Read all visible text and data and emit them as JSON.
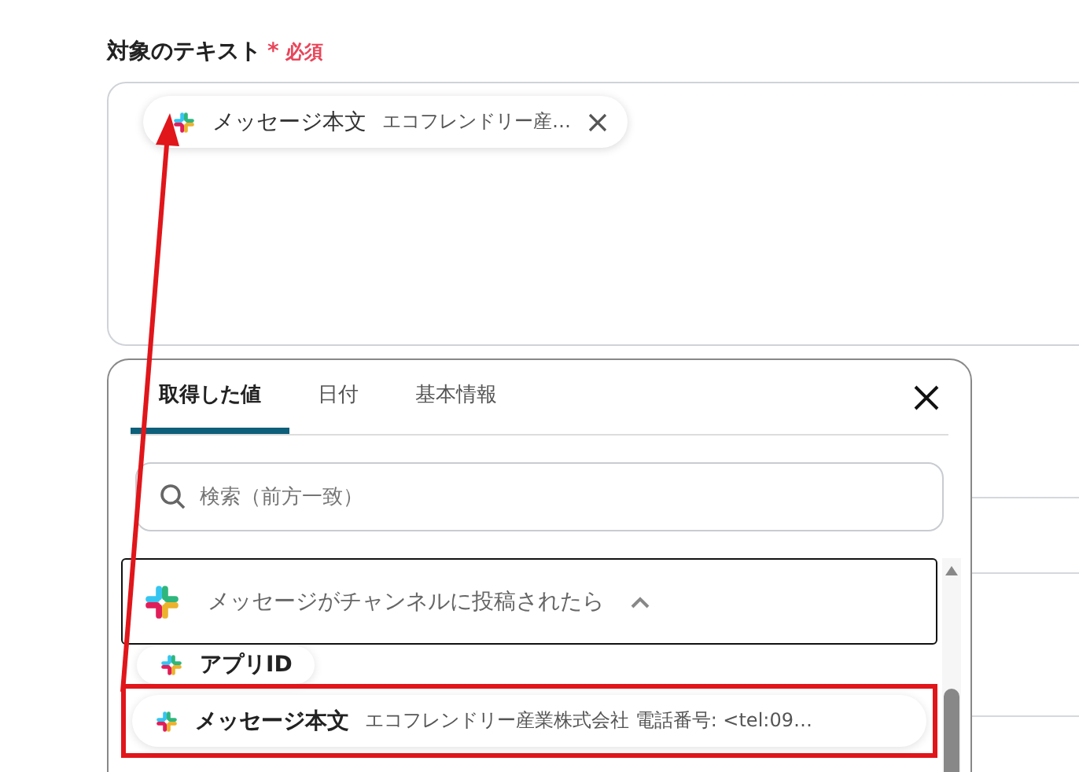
{
  "field": {
    "label": "対象のテキスト",
    "required_mark": "*",
    "required_text": "必須",
    "chips": [
      {
        "name": "メッセージ本文",
        "value": "エコフレンドリー産…"
      }
    ]
  },
  "picker": {
    "tabs": [
      {
        "label": "取得した値",
        "selected": true
      },
      {
        "label": "日付",
        "selected": false
      },
      {
        "label": "基本情報",
        "selected": false
      }
    ],
    "search": {
      "placeholder": "検索（前方一致）"
    },
    "group": {
      "title": "メッセージがチャンネルに投稿されたら",
      "expanded": true
    },
    "items": [
      {
        "name": "アプリID",
        "highlighted": false
      },
      {
        "name": "メッセージ本文",
        "value": "エコフレンドリー産業株式会社 電話番号: <tel:09…",
        "highlighted": true
      }
    ]
  }
}
